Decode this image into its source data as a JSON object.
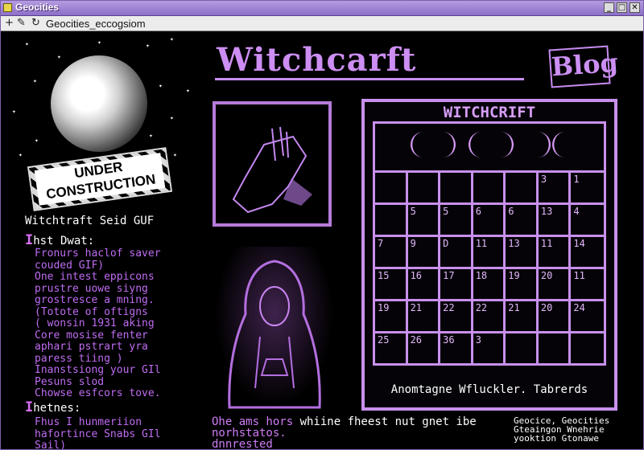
{
  "window": {
    "title": "Geocities"
  },
  "toolbar": {
    "address": "Geocities_eccogsiom"
  },
  "header": {
    "site_title": "Witchcarft",
    "blog_label": "Blog"
  },
  "under_construction": {
    "label": "UNDER CONSTRUCTION"
  },
  "sidebar": {
    "tagline": "Witchtraft Seid GUF",
    "section1": {
      "cap": "I",
      "rest": "hst Dwat:"
    },
    "list1": "Fronurs haclof saver\ncouded GIF)\nOne intest eppicons\nprustre uowe siyng\ngrostresce a mning.\n(Totote of oftigns\n( wonsin 1931 aking\nCore mosise fenter\naphari pstrart yra\nparess tiing )\nInanstsiong your GIl\nPesuns slod\nChowse esfcors tove.",
    "section2": {
      "cap": "I",
      "rest": "hetnes:"
    },
    "list2": "Fhus I hunmeriion\nhafortince Snabs GIl\nSail)"
  },
  "calendar": {
    "title": "WITCHCRIFT",
    "days": [
      "",
      "",
      "",
      "",
      "",
      "3",
      "1",
      "",
      "5",
      "5",
      "6",
      "6",
      "13",
      "4",
      "7",
      "9",
      "D",
      "11",
      "13",
      "11",
      "14",
      "15",
      "16",
      "17",
      "18",
      "19",
      "20",
      "11",
      "19",
      "21",
      "22",
      "22",
      "21",
      "20",
      "24",
      "25",
      "26",
      "36",
      "3",
      "",
      ""
    ],
    "footer": "Anomtagne Wfluckler. Tabrerds"
  },
  "bottom": {
    "line1a": "Ohe ams hors ",
    "line1b": "whiine fheest nut gnet ibe",
    "line2": "norhstatos.",
    "line3": "dnnrested"
  },
  "footer": {
    "text": "Geocice, Geocities\nGteaingon Wnehrie\nyooktion Gtonawe"
  }
}
